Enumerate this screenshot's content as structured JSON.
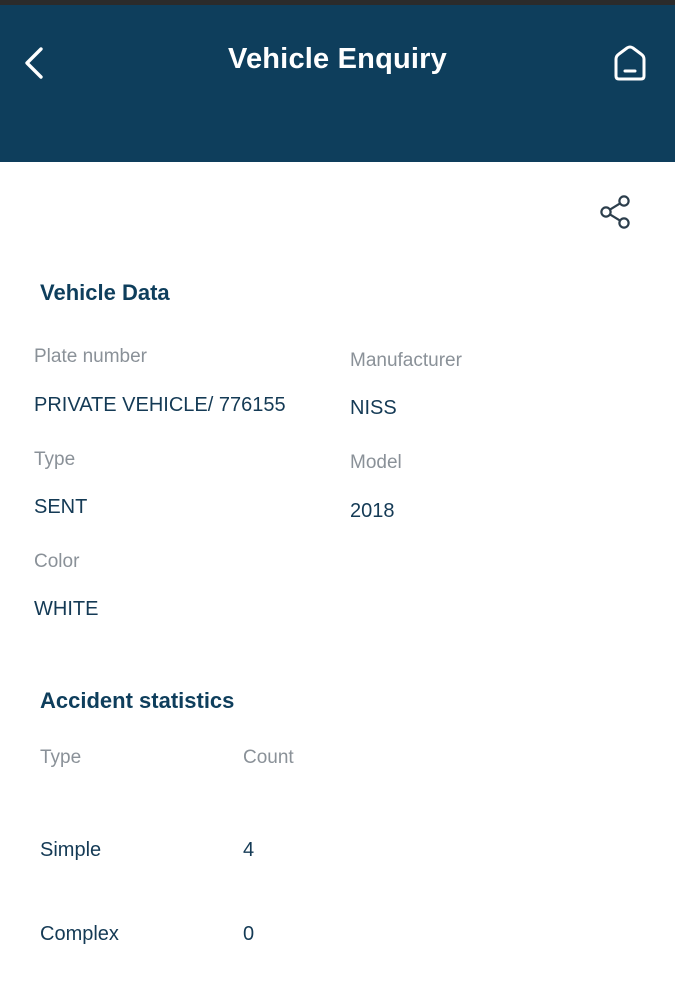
{
  "header": {
    "title": "Vehicle Enquiry",
    "back_icon": "chevron-left-icon",
    "home_icon": "home-icon",
    "background_color": "#0e3e5c"
  },
  "actions": {
    "share_icon": "share-icon"
  },
  "vehicle_data": {
    "section_title": "Vehicle Data",
    "plate_number_label": "Plate number",
    "plate_number_value": "PRIVATE VEHICLE/ 776155",
    "manufacturer_label": "Manufacturer",
    "manufacturer_value": "NISS",
    "type_label": "Type",
    "type_value": "SENT",
    "model_label": "Model",
    "model_value": "2018",
    "color_label": "Color",
    "color_value": "WHITE"
  },
  "accident_statistics": {
    "section_title": "Accident statistics",
    "columns": [
      "Type",
      "Count"
    ],
    "rows": [
      {
        "type": "Simple",
        "count": "4"
      },
      {
        "type": "Complex",
        "count": "0"
      }
    ]
  }
}
